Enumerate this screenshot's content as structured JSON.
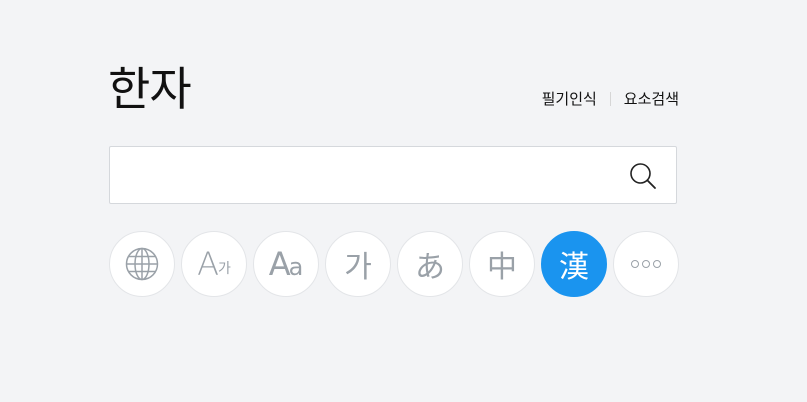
{
  "page": {
    "title": "한자"
  },
  "top_links": [
    {
      "label": "필기인식"
    },
    {
      "label": "요소검색"
    }
  ],
  "search": {
    "value": "",
    "placeholder": "",
    "icon": "search-icon"
  },
  "dictionaries": [
    {
      "name": "globe",
      "icon": "globe-icon",
      "active": false
    },
    {
      "name": "english-korean",
      "big": "A",
      "small": "가",
      "active": false
    },
    {
      "name": "english",
      "big": "A",
      "small": "a",
      "active": false
    },
    {
      "name": "korean",
      "glyph": "가",
      "active": false
    },
    {
      "name": "japanese",
      "glyph": "あ",
      "active": false
    },
    {
      "name": "chinese",
      "glyph": "中",
      "active": false
    },
    {
      "name": "hanja",
      "glyph": "漢",
      "active": true
    },
    {
      "name": "more",
      "icon": "more-dots-icon",
      "active": false
    }
  ],
  "colors": {
    "background": "#f3f4f6",
    "accent": "#1a94ef",
    "icon_gray": "#9aa1a8",
    "text": "#111111"
  }
}
